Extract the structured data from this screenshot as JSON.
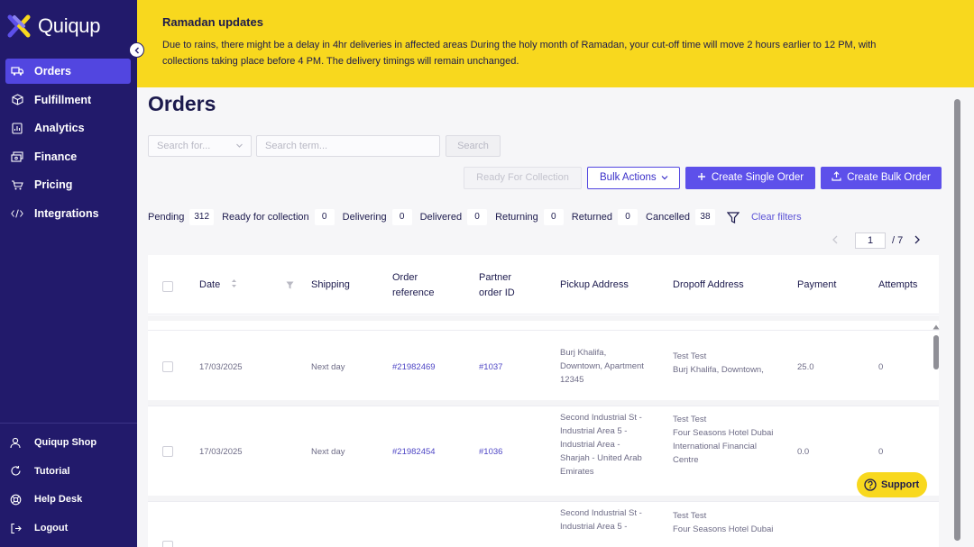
{
  "app": {
    "name": "Quiqup"
  },
  "sidebar": {
    "items": [
      {
        "label": "Orders",
        "icon": "truck-icon",
        "active": true
      },
      {
        "label": "Fulfillment",
        "icon": "box-icon"
      },
      {
        "label": "Analytics",
        "icon": "chart-icon"
      },
      {
        "label": "Finance",
        "icon": "money-icon"
      },
      {
        "label": "Pricing",
        "icon": "cart-icon"
      },
      {
        "label": "Integrations",
        "icon": "code-icon"
      }
    ],
    "bottom_items": [
      {
        "label": "Quiqup Shop",
        "icon": "user-icon"
      },
      {
        "label": "Tutorial",
        "icon": "refresh-icon"
      },
      {
        "label": "Help Desk",
        "icon": "lifebuoy-icon"
      },
      {
        "label": "Logout",
        "icon": "logout-icon"
      }
    ]
  },
  "banner": {
    "title": "Ramadan updates",
    "text": "Due to rains, there might be a delay in 4hr deliveries in affected areas During the holy month of Ramadan, your cut-off time will move 2 hours earlier to 12 PM, with collections taking place before 4 PM. The delivery timings will remain unchanged."
  },
  "page": {
    "title": "Orders"
  },
  "search": {
    "select_placeholder": "Search for...",
    "input_placeholder": "Search term...",
    "button_label": "Search"
  },
  "actions": {
    "ready_label": "Ready For Collection",
    "bulk_label": "Bulk Actions",
    "create_single_label": "Create Single Order",
    "create_bulk_label": "Create Bulk Order"
  },
  "filters": [
    {
      "label": "Pending",
      "count": "312"
    },
    {
      "label": "Ready for collection",
      "count": "0"
    },
    {
      "label": "Delivering",
      "count": "0"
    },
    {
      "label": "Delivered",
      "count": "0"
    },
    {
      "label": "Returning",
      "count": "0"
    },
    {
      "label": "Returned",
      "count": "0"
    },
    {
      "label": "Cancelled",
      "count": "38"
    }
  ],
  "clear_filters_label": "Clear filters",
  "pagination": {
    "current": "1",
    "total": "/ 7"
  },
  "table": {
    "headers": {
      "date": "Date",
      "shipping": "Shipping",
      "order_ref_1": "Order",
      "order_ref_2": "reference",
      "partner_1": "Partner",
      "partner_2": "order ID",
      "pickup": "Pickup Address",
      "dropoff": "Dropoff Address",
      "payment": "Payment",
      "attempts": "Attempts"
    },
    "rows": [
      {
        "date": "17/03/2025",
        "shipping": "Next day",
        "order_ref": "#21982469",
        "partner_id": "#1037",
        "pickup": [
          "Burj Khalifa,",
          "Downtown, Apartment",
          "12345"
        ],
        "dropoff_name": "Test Test",
        "dropoff": [
          "Burj Khalifa, Downtown,"
        ],
        "payment": "25.0",
        "attempts": "0"
      },
      {
        "date": "17/03/2025",
        "shipping": "Next day",
        "order_ref": "#21982454",
        "partner_id": "#1036",
        "pickup": [
          "Second Industrial St -",
          "Industrial Area 5 -",
          "Industrial Area -",
          "Sharjah - United Arab",
          "Emirates"
        ],
        "dropoff_name": "Test Test",
        "dropoff": [
          "Four Seasons Hotel Dubai",
          "International Financial",
          "Centre"
        ],
        "payment": "0.0",
        "attempts": "0"
      },
      {
        "pickup": [
          "Second Industrial St -",
          "Industrial Area 5 -"
        ],
        "dropoff_name": "Test Test",
        "dropoff": [
          "Four Seasons Hotel Dubai"
        ]
      }
    ]
  },
  "support_label": "Support",
  "colors": {
    "sidebar": "#221a6b",
    "accent": "#5d50ea",
    "banner": "#f8d81e"
  }
}
